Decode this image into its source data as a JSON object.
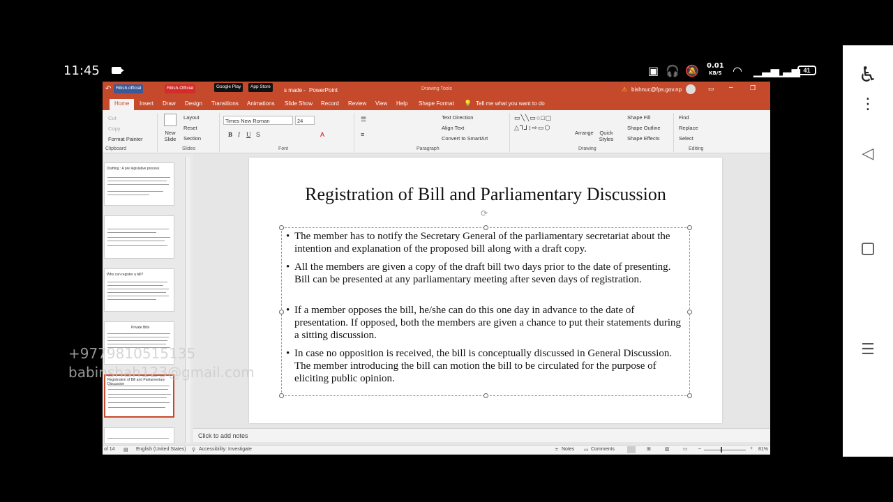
{
  "status": {
    "time": "11:45",
    "speed_value": "0.01",
    "speed_unit": "KB/S",
    "battery": "41"
  },
  "window": {
    "doc_title": "s made",
    "app_name": "PowerPoint",
    "context_label": "Drawing Tools",
    "user": "bishnuc@fps.gov.np",
    "badges": [
      "Ritish.official",
      "Ritish-Official",
      "Google Play",
      "App Store"
    ]
  },
  "tabs": [
    "Home",
    "Insert",
    "Draw",
    "Design",
    "Transitions",
    "Animations",
    "Slide Show",
    "Record",
    "Review",
    "View",
    "Help",
    "Shape Format"
  ],
  "tell_me": "Tell me what you want to do",
  "ribbon": {
    "clipboard": {
      "cut": "Cut",
      "copy": "Copy",
      "format_painter": "Format Painter",
      "label": "Clipboard"
    },
    "slides": {
      "new_slide": "New Slide",
      "layout": "Layout",
      "reset": "Reset",
      "section": "Section",
      "label": "Slides"
    },
    "font": {
      "family": "Times New Roman",
      "size": "24",
      "label": "Font"
    },
    "paragraph": {
      "text_direction": "Text Direction",
      "align_text": "Align Text",
      "smartart": "Convert to SmartArt",
      "label": "Paragraph"
    },
    "drawing": {
      "arrange": "Arrange",
      "quick_styles": "Quick Styles",
      "fill": "Shape Fill",
      "outline": "Shape Outline",
      "effects": "Shape Effects",
      "label": "Drawing"
    },
    "editing": {
      "find": "Find",
      "replace": "Replace",
      "select": "Select",
      "label": "Editing"
    }
  },
  "thumbnails": [
    "Drafting : A pre legislative process",
    "",
    "Who can register a bill?",
    "Private Bills",
    "Registration of Bill and Parliamentary Discussion"
  ],
  "slide": {
    "title": "Registration of Bill and Parliamentary Discussion",
    "bullets": [
      "The member has to notify the Secretary General of the parliamentary secretariat about the intention and explanation of the proposed bill along with a draft copy.",
      "All the members are given a copy of the draft bill two days prior to the date of presenting. Bill can be presented at any parliamentary meeting after seven days of registration.",
      "If a member opposes the bill, he/she can do this one day in advance to the date of presentation. If opposed, both the members are given a chance to put their statements during a sitting discussion.",
      "In case no opposition is received, the bill is conceptually discussed in General Discussion. The member introducing the bill can motion the bill to be circulated for the purpose of eliciting public opinion."
    ]
  },
  "notes_placeholder": "Click to add notes",
  "statusbar": {
    "slide_count": "of 14",
    "language": "English (United States)",
    "accessibility": "Accessibility: Investigate",
    "notes": "Notes",
    "comments": "Comments",
    "zoom": "81%"
  },
  "watermark": {
    "phone": "+9779810515135",
    "email": "babinshah123@gmail.com"
  }
}
